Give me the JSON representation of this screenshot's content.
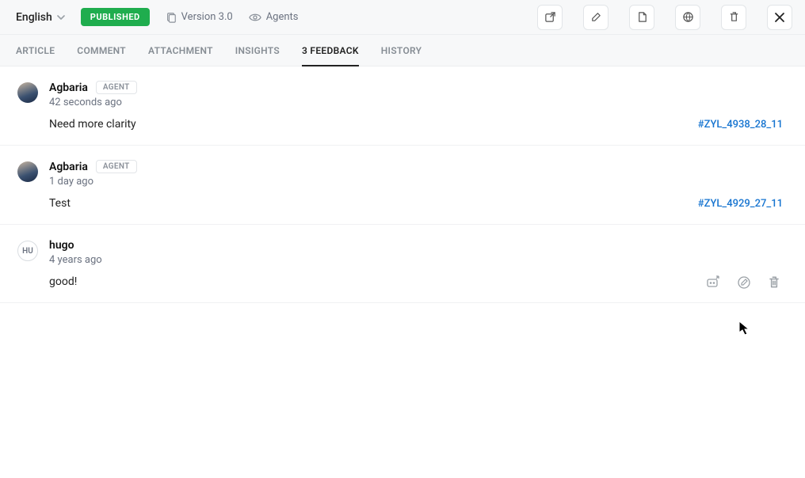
{
  "header": {
    "language": "English",
    "status": "PUBLISHED",
    "version_label": "Version 3.0",
    "visibility_label": "Agents"
  },
  "tabs": {
    "article": "ARTICLE",
    "comment": "COMMENT",
    "attachment": "ATTACHMENT",
    "insights": "INSIGHTS",
    "feedback": "3 FEEDBACK",
    "history": "HISTORY"
  },
  "feedback": [
    {
      "name": "Agbaria",
      "role": "AGENT",
      "time": "42 seconds ago",
      "body": "Need more clarity",
      "ref": "#ZYL_4938_28_11",
      "avatar_type": "photo"
    },
    {
      "name": "Agbaria",
      "role": "AGENT",
      "time": "1 day ago",
      "body": "Test",
      "ref": "#ZYL_4929_27_11",
      "avatar_type": "photo"
    },
    {
      "name": "hugo",
      "role": "",
      "time": "4 years ago",
      "body": "good!",
      "ref": "",
      "avatar_type": "text",
      "avatar_text": "HU"
    }
  ]
}
